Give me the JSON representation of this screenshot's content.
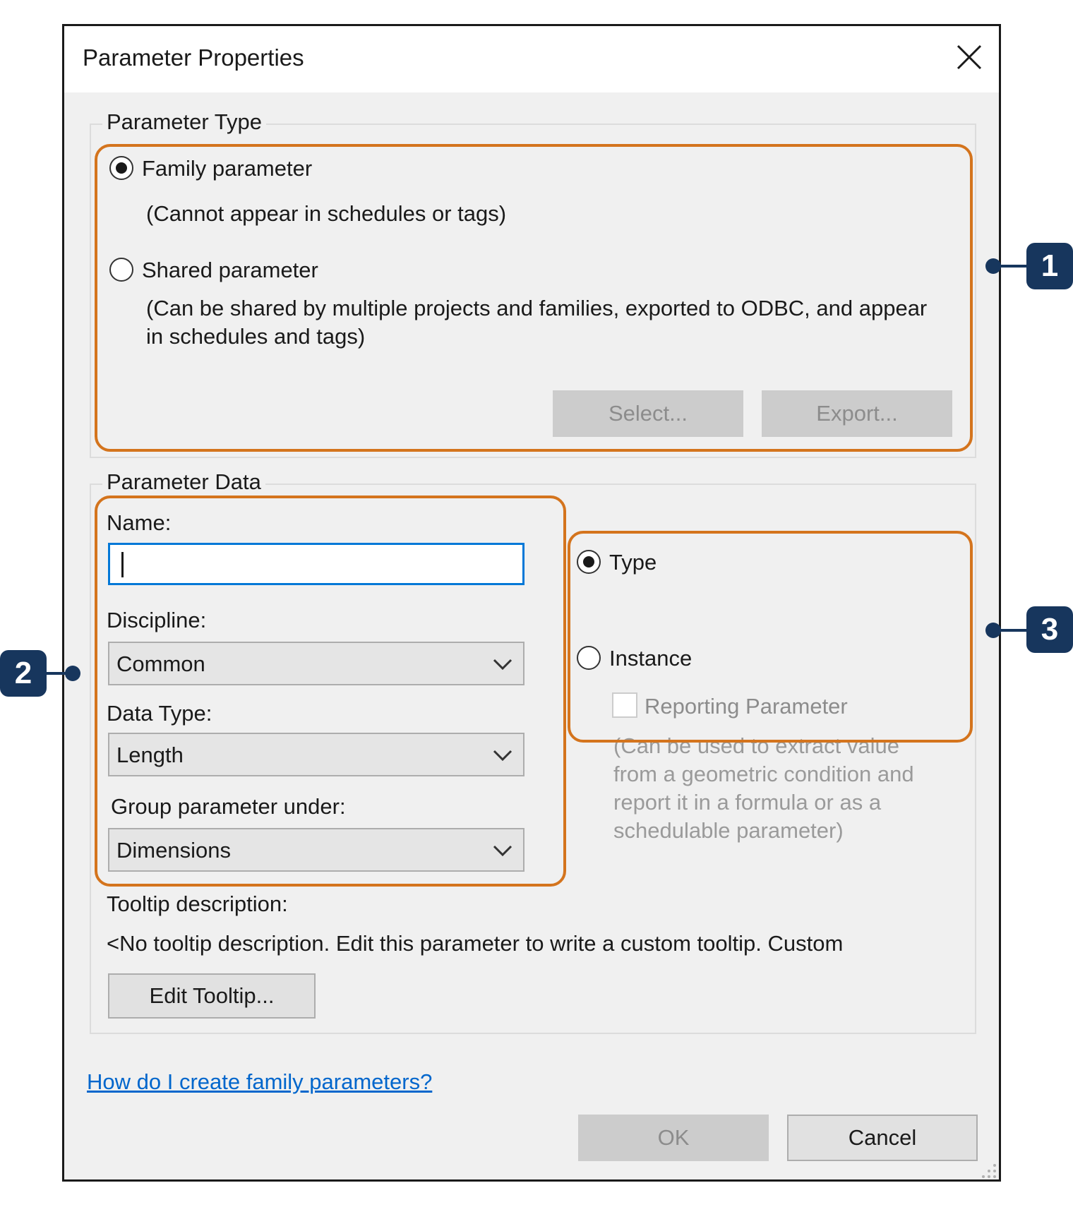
{
  "dialog": {
    "title": "Parameter Properties",
    "close_icon": "close-icon"
  },
  "parameter_type": {
    "legend": "Parameter Type",
    "family_label": "Family parameter",
    "family_note": "(Cannot appear in schedules or tags)",
    "shared_label": "Shared parameter",
    "shared_note": "(Can be shared by multiple projects and families, exported to ODBC, and appear in schedules and tags)",
    "select_button": "Select...",
    "export_button": "Export...",
    "selected": "Family parameter"
  },
  "parameter_data": {
    "legend": "Parameter Data",
    "name_label": "Name:",
    "name_value": "",
    "discipline_label": "Discipline:",
    "discipline_value": "Common",
    "data_type_label": "Data Type:",
    "data_type_value": "Length",
    "group_label": "Group parameter under:",
    "group_value": "Dimensions",
    "type_label": "Type",
    "instance_label": "Instance",
    "selected_scope": "Type",
    "reporting_label": "Reporting Parameter",
    "reporting_checked": false,
    "reporting_note": "(Can be used to extract value from a geometric condition and report it in a formula or as a schedulable parameter)",
    "tooltip_label": "Tooltip description:",
    "tooltip_text": "<No tooltip description. Edit this parameter to write a custom tooltip. Custom",
    "edit_tooltip_button": "Edit Tooltip..."
  },
  "help_link": "How do I create family parameters?",
  "footer": {
    "ok_button": "OK",
    "cancel_button": "Cancel"
  },
  "callouts": {
    "one": "1",
    "two": "2",
    "three": "3"
  },
  "colors": {
    "callout_border": "#d4741d",
    "badge": "#17365d",
    "link": "#0066cc",
    "focus": "#0078d7"
  }
}
